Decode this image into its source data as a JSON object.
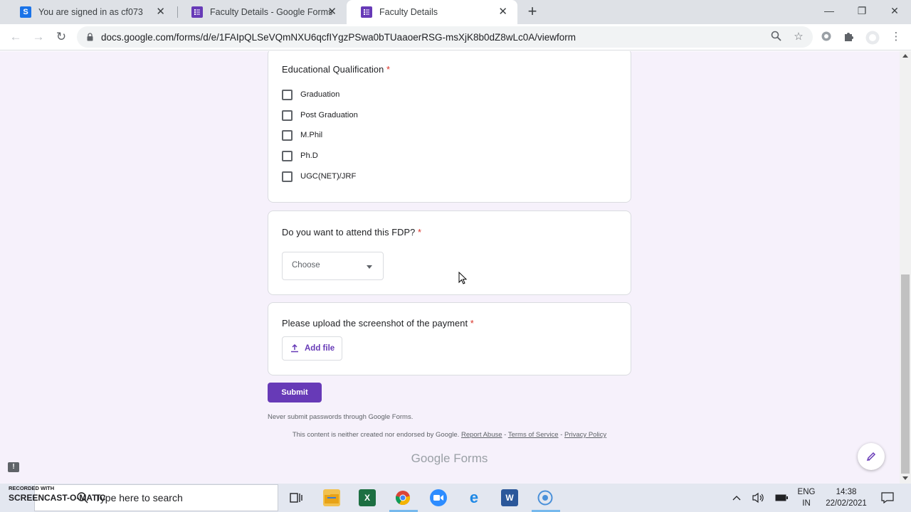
{
  "browser": {
    "tabs": [
      {
        "title": "You are signed in as cf073",
        "favicon": "S",
        "favicon_color": "#1a73e8",
        "active": false
      },
      {
        "title": "Faculty Details - Google Forms",
        "favicon": "forms",
        "favicon_color": "#673ab7",
        "active": false
      },
      {
        "title": "Faculty Details",
        "favicon": "forms",
        "favicon_color": "#673ab7",
        "active": true
      }
    ],
    "url": "docs.google.com/forms/d/e/1FAIpQLSeVQmNXU6qcfIYgzPSwa0bTUaaoerRSG-msXjK8b0dZ8wLc0A/viewform"
  },
  "form": {
    "qualification": {
      "title": "Educational Qualification",
      "required_mark": "*",
      "options": [
        "Graduation",
        "Post Graduation",
        "M.Phil",
        "Ph.D",
        "UGC(NET)/JRF"
      ]
    },
    "fdp": {
      "title": "Do you want to attend this FDP?",
      "required_mark": "*",
      "select_placeholder": "Choose"
    },
    "upload": {
      "title": "Please upload the screenshot of the payment",
      "required_mark": "*",
      "button_label": "Add file"
    },
    "submit_label": "Submit",
    "password_note": "Never submit passwords through Google Forms.",
    "footer": {
      "disclaimer": "This content is neither created nor endorsed by Google.",
      "report_abuse": "Report Abuse",
      "sep1": " - ",
      "terms": "Terms of Service",
      "sep2": " - ",
      "privacy": "Privacy Policy"
    },
    "brand_google": "Google",
    "brand_forms": "Forms"
  },
  "taskbar": {
    "search_placeholder": "Type here to search",
    "watermark_small": "RECORDED WITH",
    "watermark_big": "SCREENCAST-O-MATIC",
    "lang_line1": "ENG",
    "lang_line2": "IN",
    "time": "14:38",
    "date": "22/02/2021"
  },
  "colors": {
    "accent": "#673ab7",
    "page_bg": "#f6f1fb",
    "required": "#d93025"
  }
}
